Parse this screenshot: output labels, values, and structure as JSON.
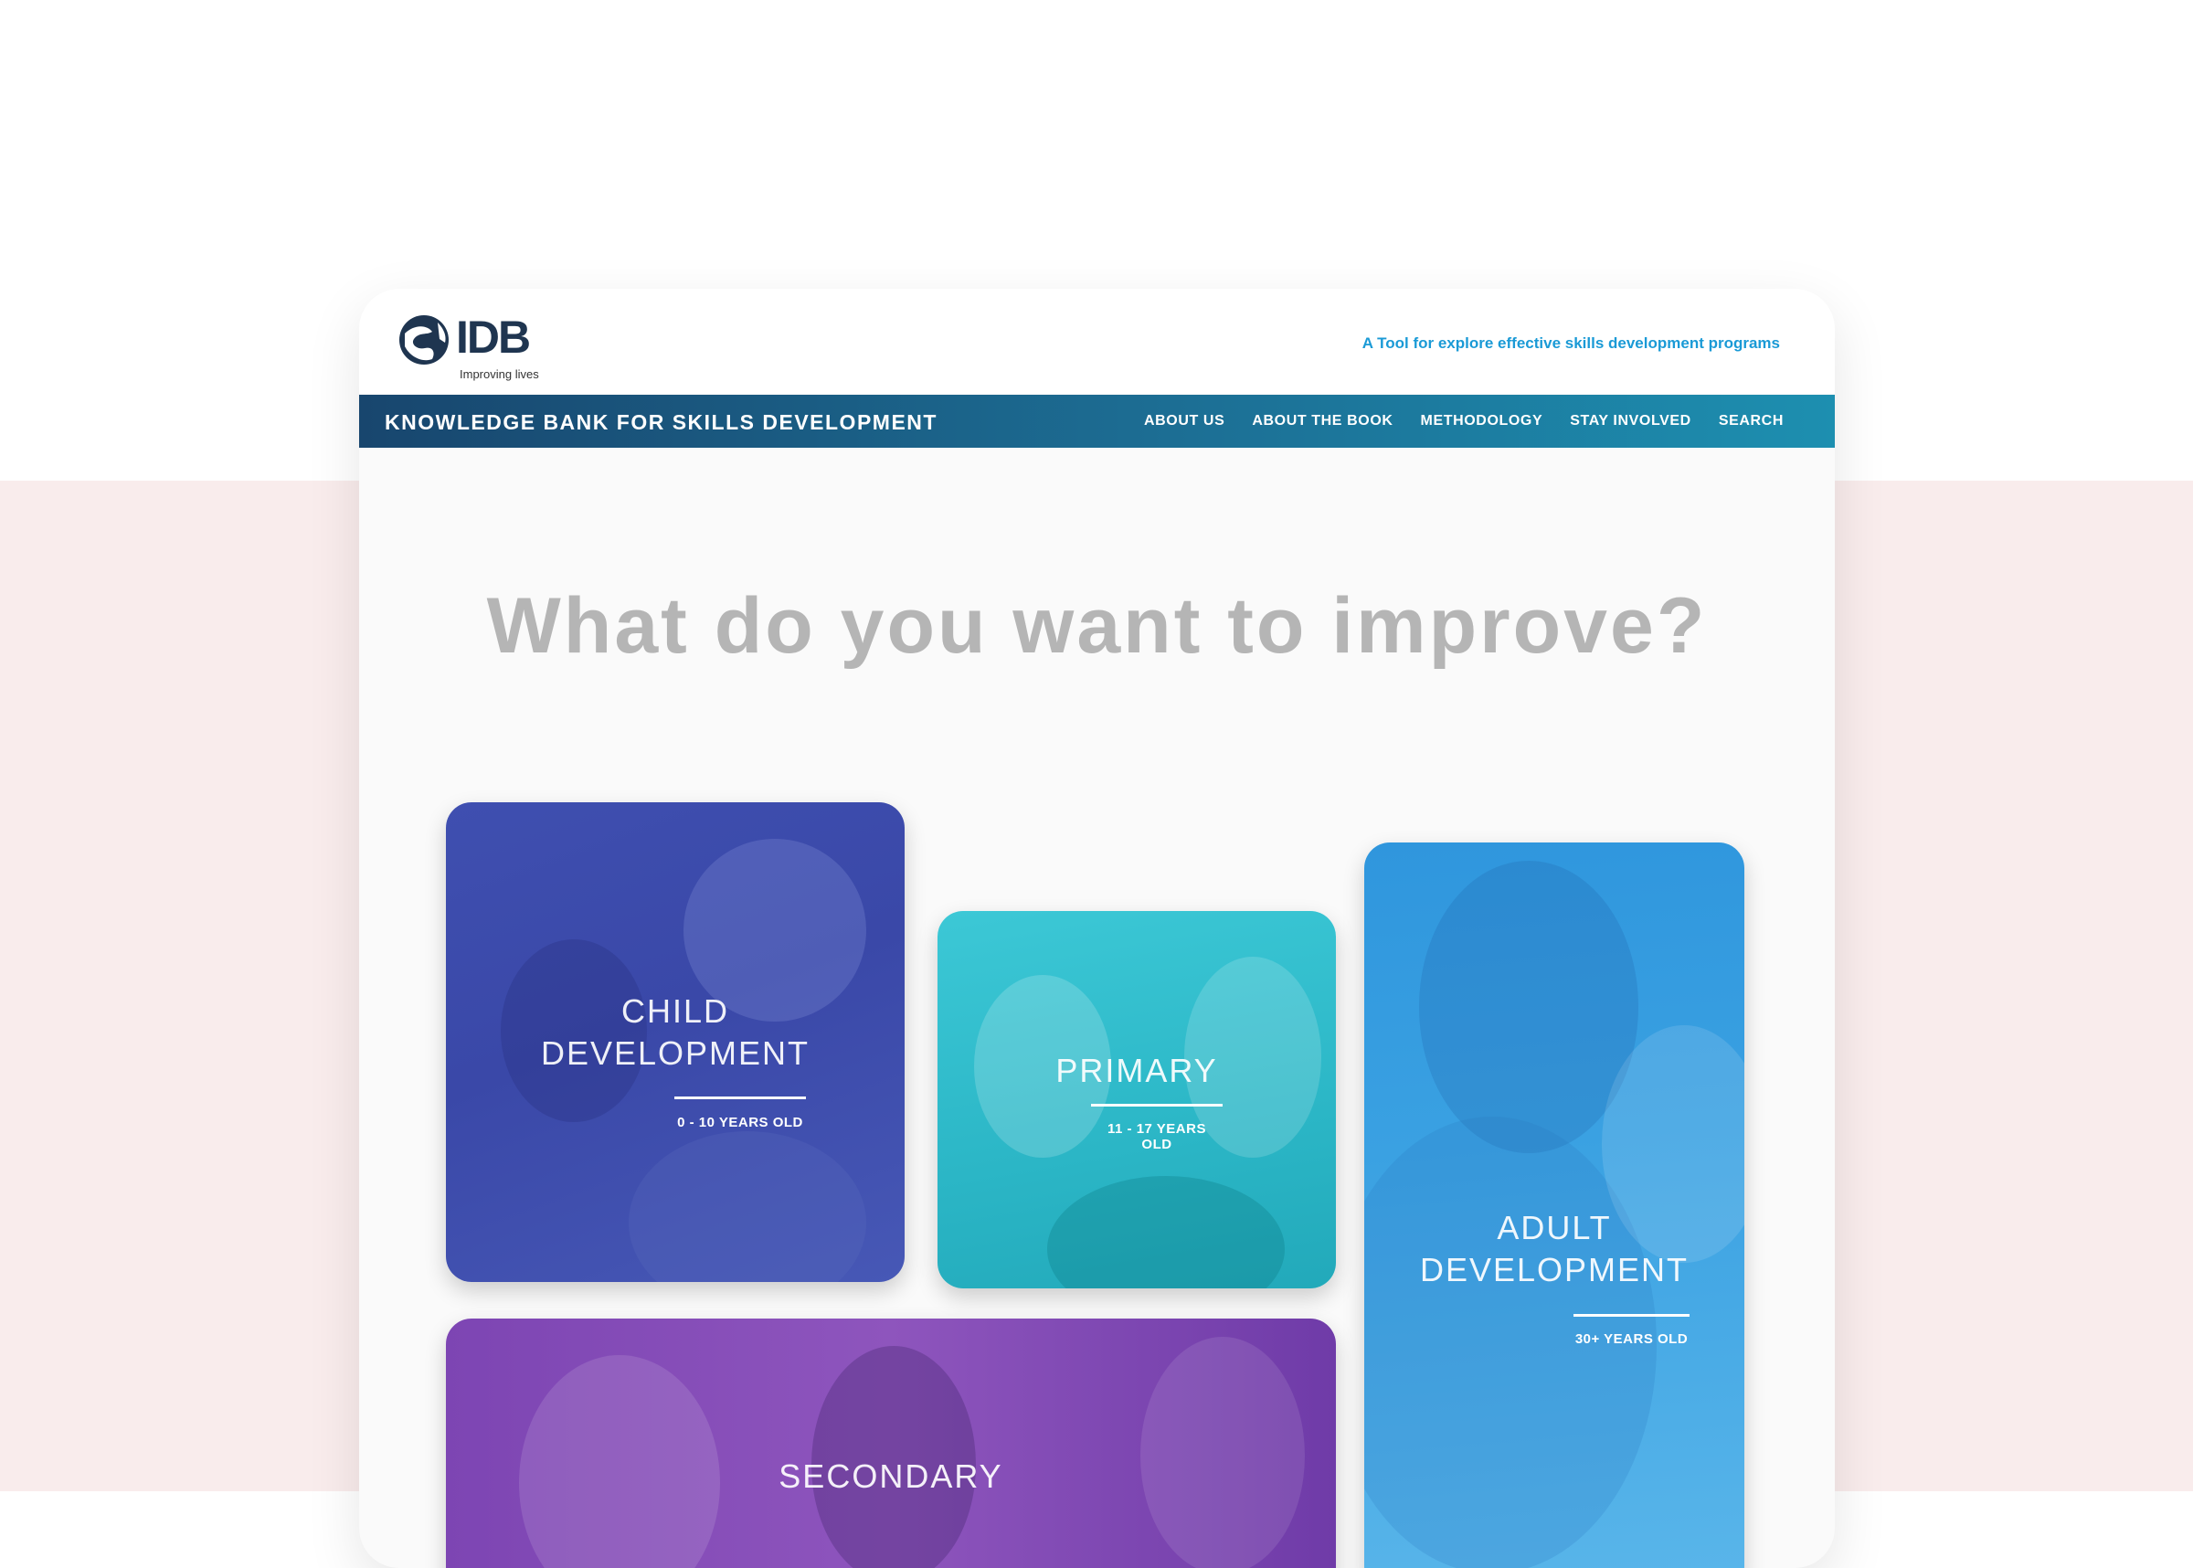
{
  "header": {
    "logo_text": "IDB",
    "logo_subtext": "Improving lives",
    "tagline": "A Tool for explore effective skills development programs"
  },
  "nav": {
    "site_title": "KNOWLEDGE BANK FOR SKILLS DEVELOPMENT",
    "links": [
      "ABOUT US",
      "ABOUT THE BOOK",
      "METHODOLOGY",
      "STAY INVOLVED",
      "SEARCH"
    ]
  },
  "main": {
    "heading": "What do you want to improve?"
  },
  "cards": {
    "child": {
      "title_line1": "CHILD",
      "title_line2": "DEVELOPMENT",
      "subtitle": "0 - 10 YEARS OLD"
    },
    "primary": {
      "title": "PRIMARY",
      "subtitle": "11 - 17 YEARS OLD"
    },
    "adult": {
      "title_line1": "ADULT",
      "title_line2": "DEVELOPMENT",
      "subtitle": "30+ YEARS OLD"
    },
    "secondary": {
      "title": "SECONDARY"
    }
  },
  "colors": {
    "page_background": "#ffffff",
    "pink_band": "#f9ecec",
    "nav_start": "#18466e",
    "nav_end": "#1d8fb0",
    "tagline": "#1a9ad6",
    "heading": "#b5b5b5",
    "child_card": "#3f4fb0",
    "primary_card": "#2bb6c6",
    "adult_card": "#3aa1e2",
    "secondary_card": "#8e55bd"
  }
}
